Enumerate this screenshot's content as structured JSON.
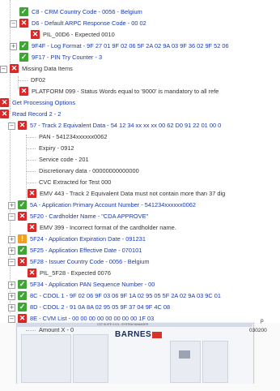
{
  "tree": {
    "rows": [
      {
        "icon": "pass",
        "text": "C8 - CRM Country Code - 0056 - Belgium"
      },
      {
        "icon": "fail",
        "text": "D6 - Default ARPC Response Code - 00 02"
      },
      {
        "icon": "fail",
        "text": "PIL_00D6 - Expected 0010"
      },
      {
        "icon": "pass",
        "text": "9F4F - Log Format - 9F 27 01 9F 02 06 5F 2A 02 9A 03 9F 36 02 9F 52 06"
      },
      {
        "icon": "pass",
        "text": "9F17 - PIN Try Counter - 3"
      },
      {
        "icon": "fail",
        "text": "Missing Data Items"
      },
      {
        "icon": "",
        "text": "DF02"
      },
      {
        "icon": "fail",
        "text": "PLATFORM 099 - Status Words equal to '9000' is mandatory to all refe"
      },
      {
        "icon": "fail",
        "text": "Get Processing Options"
      },
      {
        "icon": "fail",
        "text": "Read Record 2 - 2"
      },
      {
        "icon": "fail",
        "text": "57 - Track 2 Equivalent Data - 54 12 34 xx xx xx 00 62 D0 91 22 01 00 0"
      },
      {
        "icon": "",
        "text": "PAN - 541234xxxxxx0062"
      },
      {
        "icon": "",
        "text": "Expiry - 0912"
      },
      {
        "icon": "",
        "text": "Service code - 201"
      },
      {
        "icon": "",
        "text": "Discretionary data - 00000000000000"
      },
      {
        "icon": "",
        "text": "CVC Extracted for Test 000"
      },
      {
        "icon": "fail",
        "text": "EMV 443 - Track 2 Equivalent Data must not contain more than 37 dig"
      },
      {
        "icon": "pass",
        "text": "5A - Application Primary Account Number - 541234xxxxxx0062"
      },
      {
        "icon": "fail",
        "text": "5F20 - Cardholder Name - \"CDA APPROVE\""
      },
      {
        "icon": "fail",
        "text": "EMV 399 - Incorrect format of the cardholder name."
      },
      {
        "icon": "warn",
        "text": "5F24 - Application Expiration Date - 091231"
      },
      {
        "icon": "pass",
        "text": "5F25 - Application Effective Date - 070101"
      },
      {
        "icon": "fail",
        "text": "5F28 - Issuer Country Code - 0056 - Belgium"
      },
      {
        "icon": "fail",
        "text": "PIL_5F28 - Expected 0076"
      },
      {
        "icon": "pass",
        "text": "5F34 - Application PAN Sequence Number - 00"
      },
      {
        "icon": "pass",
        "text": "8C - CDOL 1 - 9F 02 06 9F 03 06 9F 1A 02 95 05 5F 2A 02 9A 03 9C 01"
      },
      {
        "icon": "pass",
        "text": "8D - CDOL 2 - 91 0A 8A 02 95 05 9F 37 04 9F 4C 08"
      },
      {
        "icon": "fail",
        "text": "8E - CVM List - 00 00 00 00 00 00 00 00 1F 03"
      },
      {
        "icon": "",
        "text": "Amount X - 0"
      }
    ]
  },
  "laptop": {
    "window_title": "CST SUITE 2.0.5 - SYSTEM MANAGER",
    "brand": "BARNES",
    "right_text_1": "p",
    "right_text_2": "030200"
  }
}
